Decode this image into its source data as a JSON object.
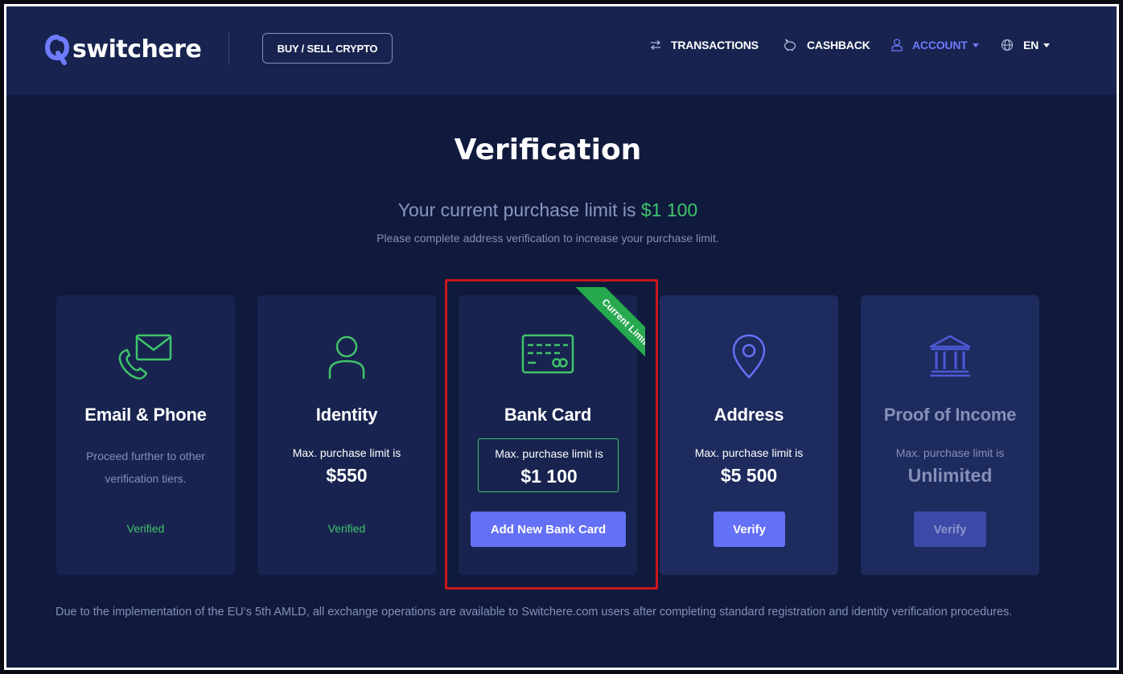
{
  "header": {
    "logo_text": "switchere",
    "buy_sell_label": "BUY / SELL CRYPTO",
    "nav": {
      "transactions": "TRANSACTIONS",
      "cashback": "CASHBACK",
      "account": "ACCOUNT",
      "language": "EN"
    }
  },
  "main": {
    "title": "Verification",
    "limit_prefix": "Your current purchase limit is ",
    "limit_amount": "$1 100",
    "limit_subtitle": "Please complete address verification to increase your purchase limit."
  },
  "cards": [
    {
      "title": "Email & Phone",
      "description": "Proceed further to other verification tiers.",
      "status": "Verified",
      "icon": "email-phone-icon"
    },
    {
      "title": "Identity",
      "limit_label": "Max. purchase limit is",
      "limit_value": "$550",
      "status": "Verified",
      "icon": "user-icon"
    },
    {
      "title": "Bank Card",
      "limit_label": "Max. purchase limit is",
      "limit_value": "$1 100",
      "button": "Add New Bank Card",
      "ribbon": "Current Limit",
      "icon": "credit-card-icon"
    },
    {
      "title": "Address",
      "limit_label": "Max. purchase limit is",
      "limit_value": "$5 500",
      "button": "Verify",
      "icon": "location-pin-icon"
    },
    {
      "title": "Proof of Income",
      "limit_label": "Max. purchase limit is",
      "limit_value": "Unlimited",
      "button": "Verify",
      "icon": "bank-icon"
    }
  ],
  "footnote": "Due to the implementation of the EU’s 5th AMLD, all exchange operations are available to Switchere.com users after completing standard registration and identity verification procedures.",
  "colors": {
    "accent": "#6470f5",
    "success": "#3fc46a",
    "highlight": "#c8161b",
    "background": "#101a3d"
  }
}
